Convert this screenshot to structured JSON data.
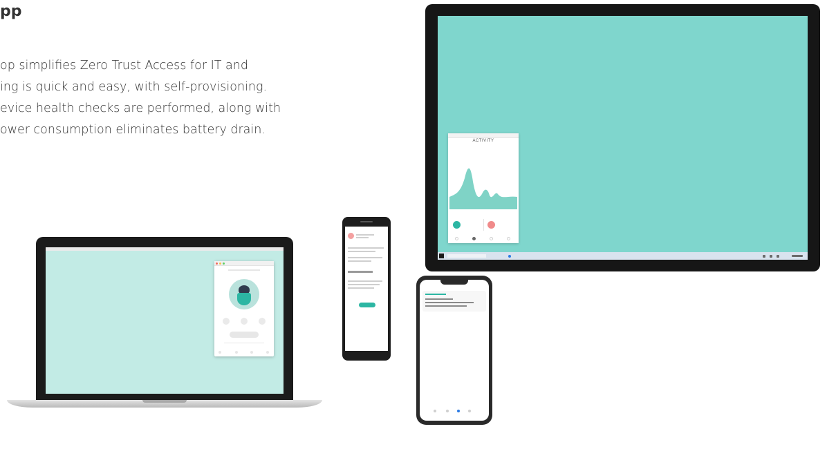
{
  "hero": {
    "title": "pp",
    "description": "op simplifies Zero Trust Access for IT and\ning is quick and easy, with self-provisioning.\nevice health checks are performed, along with\nower consumption eliminates battery drain."
  },
  "devices": {
    "desktop": {
      "app_window_title": "ACTIVITY"
    }
  },
  "colors": {
    "accent_teal": "#2cb6a3",
    "desktop_wallpaper": "#7fd6cd",
    "laptop_wallpaper": "#c2ebe5",
    "alert_red": "#f08a8a"
  }
}
